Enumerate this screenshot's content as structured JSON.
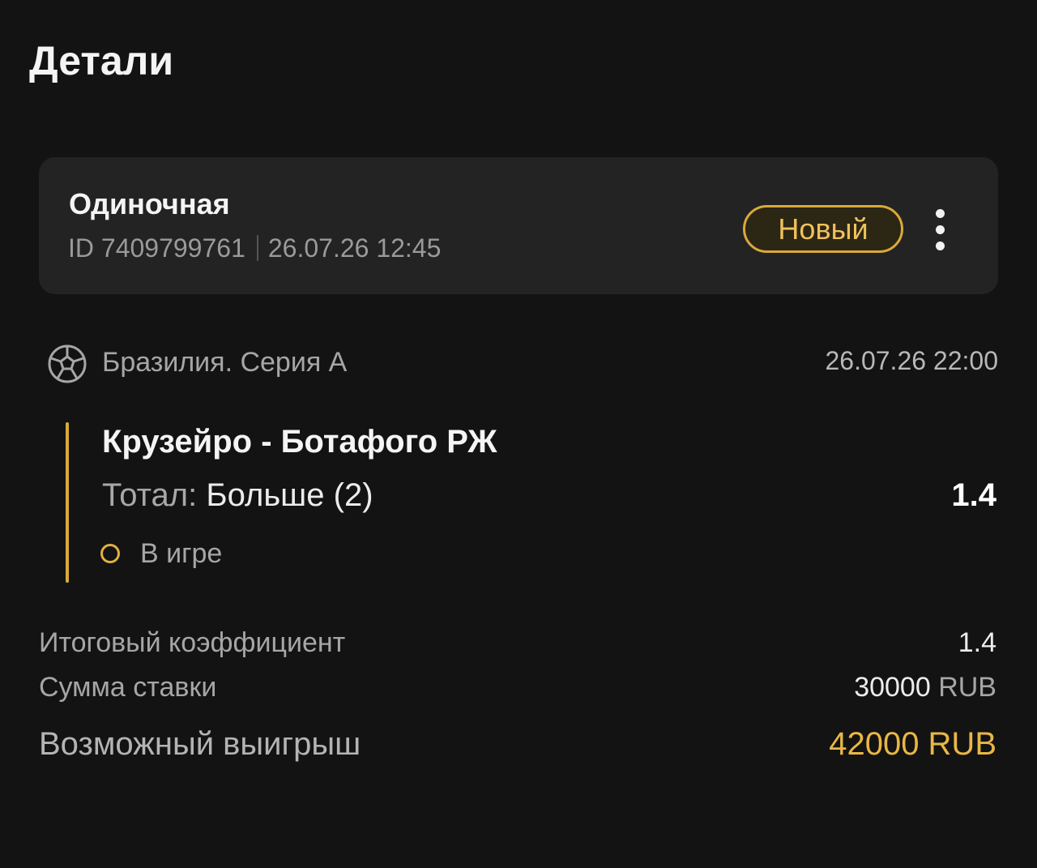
{
  "page": {
    "title": "Детали"
  },
  "bet": {
    "type": "Одиночная",
    "id_label": "ID 7409799761",
    "created_at": "26.07.26 12:45",
    "status": "Новый"
  },
  "event": {
    "league": "Бразилия. Серия А",
    "date": "26.07.26 22:00",
    "match": "Крузейро - Ботафого РЖ",
    "market_label": "Тотал:",
    "market_value": "Больше (2)",
    "odds": "1.4",
    "state": "В игре",
    "accent_color": "#d9a93a"
  },
  "summary": {
    "total_coef_label": "Итоговый коэффициент",
    "total_coef_value": "1.4",
    "stake_label": "Сумма ставки",
    "stake_amount": "30000",
    "stake_currency": "RUB",
    "win_label": "Возможный выигрыш",
    "win_value": "42000 RUB",
    "win_color": "#e9b744"
  },
  "icons": {
    "menu": "more-vertical-icon",
    "sport": "soccer-ball-icon",
    "state": "pending-circle-icon"
  }
}
